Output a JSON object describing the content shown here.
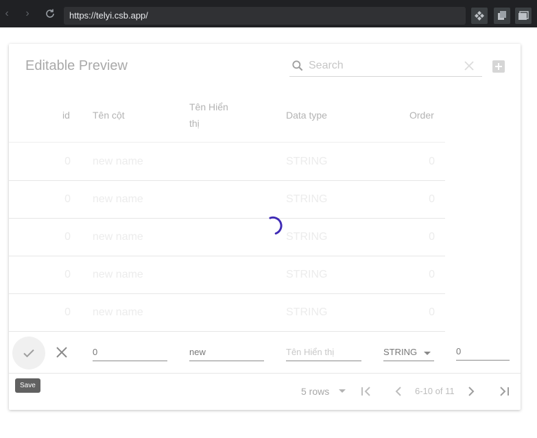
{
  "browser": {
    "url": "https://telyi.csb.app/"
  },
  "card": {
    "title": "Editable Preview",
    "search_placeholder": "Search"
  },
  "table": {
    "headers": {
      "id": "id",
      "ten_cot": "Tên cột",
      "ten_hien_thi_line1": "Tên Hiển",
      "ten_hien_thi_line2": "thị",
      "data_type": "Data type",
      "order": "Order"
    },
    "rows": [
      {
        "id": "0",
        "name": "new name",
        "type": "STRING",
        "order": "0"
      },
      {
        "id": "0",
        "name": "new name",
        "type": "STRING",
        "order": "0"
      },
      {
        "id": "0",
        "name": "new name",
        "type": "STRING",
        "order": "0"
      },
      {
        "id": "0",
        "name": "new name",
        "type": "STRING",
        "order": "0"
      },
      {
        "id": "0",
        "name": "new name",
        "type": "STRING",
        "order": "0"
      }
    ]
  },
  "edit_row": {
    "ten_cot_value": "0",
    "ten_hien_thi_value": "new",
    "display_placeholder": "Tên Hiển thị",
    "data_type_value": "STRING",
    "order_value": "0",
    "save_tooltip": "Save"
  },
  "pagination": {
    "rows_per_page": "5 rows",
    "range": "6-10 of 11"
  },
  "colors": {
    "spinner": "#3f2bb5"
  }
}
